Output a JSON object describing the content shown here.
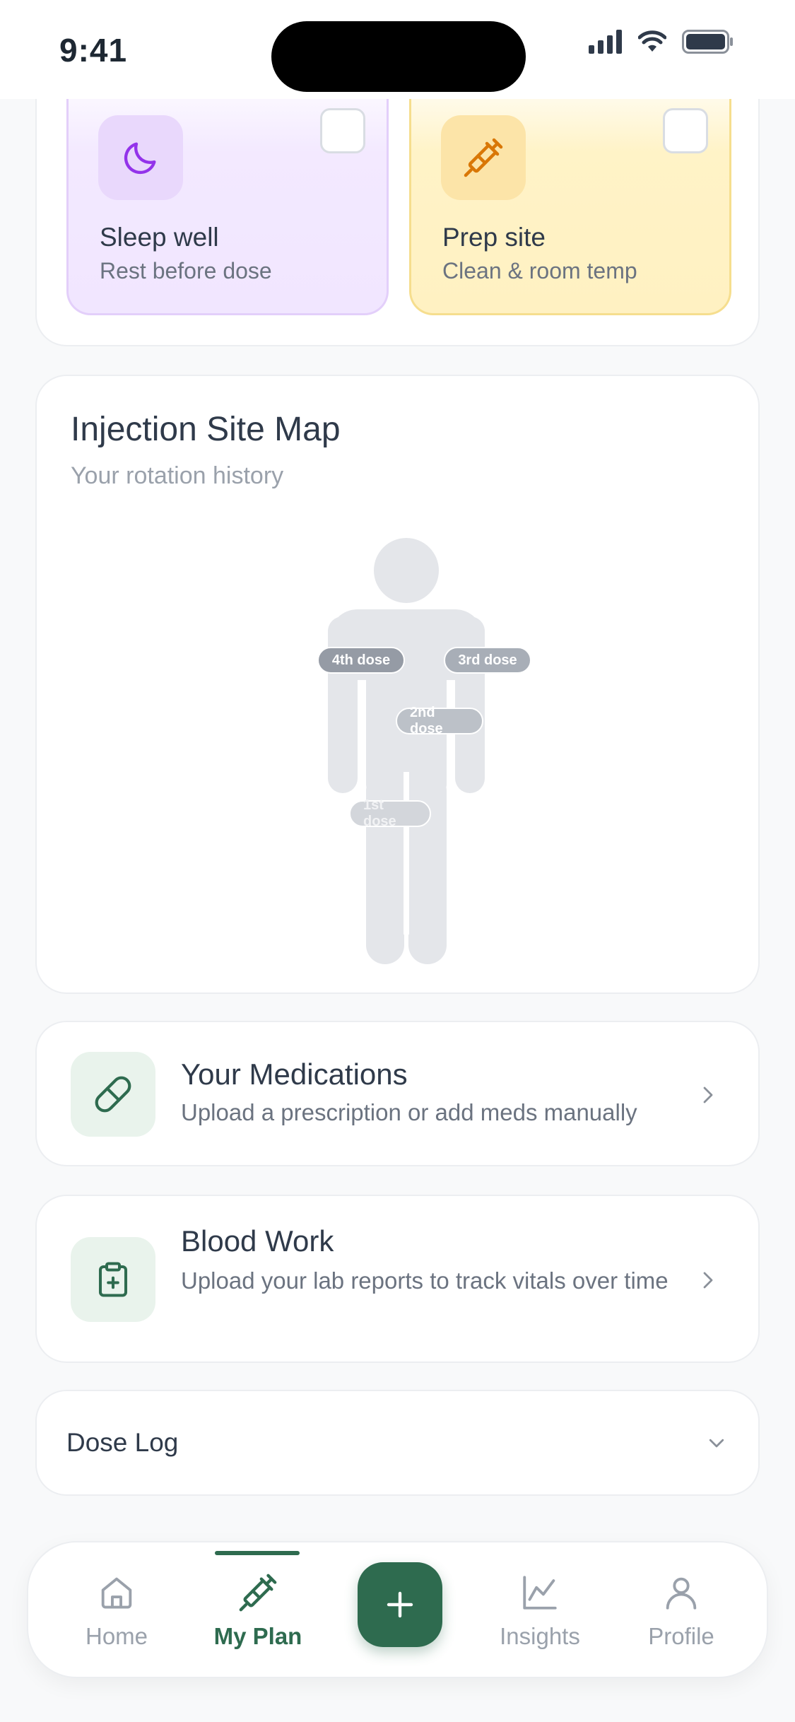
{
  "status_bar": {
    "time": "9:41"
  },
  "prep_tiles": [
    {
      "title": "Sleep well",
      "subtitle": "Rest before dose",
      "icon": "moon-icon",
      "color": "#9333EA",
      "checked": false
    },
    {
      "title": "Prep site",
      "subtitle": "Clean & room temp",
      "icon": "syringe-icon",
      "color": "#D97706",
      "checked": false
    }
  ],
  "site_map": {
    "title": "Injection Site Map",
    "subtitle": "Your rotation history",
    "doses": [
      {
        "label": "4th dose"
      },
      {
        "label": "3rd dose"
      },
      {
        "label": "2nd dose"
      },
      {
        "label": "1st dose"
      }
    ]
  },
  "medications": {
    "title": "Your Medications",
    "subtitle": "Upload a prescription or add meds manually",
    "icon": "pill-icon"
  },
  "blood_work": {
    "title": "Blood Work",
    "subtitle": "Upload your lab reports to track vitals over time",
    "icon": "clipboard-plus-icon"
  },
  "dose_log": {
    "title": "Dose Log"
  },
  "bottom_nav": {
    "items": [
      {
        "label": "Home",
        "icon": "home-icon"
      },
      {
        "label": "My Plan",
        "icon": "syringe-icon",
        "active": true
      },
      {
        "label": "Insights",
        "icon": "chart-icon"
      },
      {
        "label": "Profile",
        "icon": "user-icon"
      }
    ],
    "fab_icon": "plus-icon",
    "accent": "#2E6B4F"
  }
}
